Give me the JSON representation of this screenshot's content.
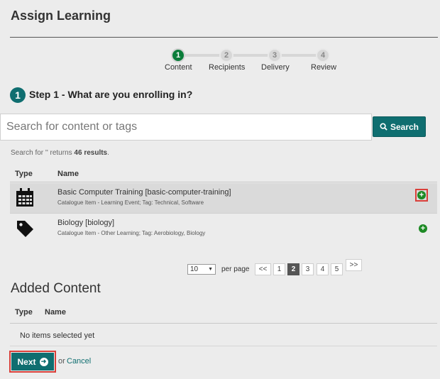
{
  "page": {
    "title": "Assign Learning"
  },
  "stepper": {
    "steps": [
      {
        "number": "1",
        "label": "Content",
        "active": true
      },
      {
        "number": "2",
        "label": "Recipients",
        "active": false
      },
      {
        "number": "3",
        "label": "Delivery",
        "active": false
      },
      {
        "number": "4",
        "label": "Review",
        "active": false
      }
    ]
  },
  "step_heading": {
    "badge": "1",
    "text": "Step 1 - What are you enrolling in?"
  },
  "search": {
    "placeholder": "Search for content or tags",
    "value": "",
    "button_label": "Search",
    "icon": "search-icon"
  },
  "search_summary": {
    "prefix": "Search for '' returns ",
    "count": "46 results",
    "suffix": "."
  },
  "results": {
    "columns": [
      "Type",
      "Name"
    ],
    "rows": [
      {
        "type_icon": "calendar-icon",
        "title": "Basic Computer Training [basic-computer-training]",
        "subtitle": "Catalogue Item - Learning Event; Tag: Technical, Software",
        "add_icon": "plus-circle-icon",
        "highlighted": true
      },
      {
        "type_icon": "tag-icon",
        "title": "Biology [biology]",
        "subtitle": "Catalogue Item - Other Learning; Tag: Aerobiology, Biology",
        "add_icon": "plus-circle-icon",
        "highlighted": false
      }
    ]
  },
  "pagination": {
    "per_page_value": "10",
    "per_page_label": "per page",
    "prev_label": "<<",
    "pages": [
      "1",
      "2",
      "3",
      "4",
      "5"
    ],
    "current_page": "2",
    "next_label": ">>"
  },
  "added_content": {
    "heading": "Added Content",
    "columns": [
      "Type",
      "Name"
    ],
    "empty_text": "No items selected yet"
  },
  "footer": {
    "next_label": "Next",
    "or_text": "or",
    "cancel_label": "Cancel"
  },
  "colors": {
    "teal": "#0f6e70",
    "green": "#1d8a25",
    "active_step": "#0b7d3a",
    "highlight": "#d9403a"
  }
}
